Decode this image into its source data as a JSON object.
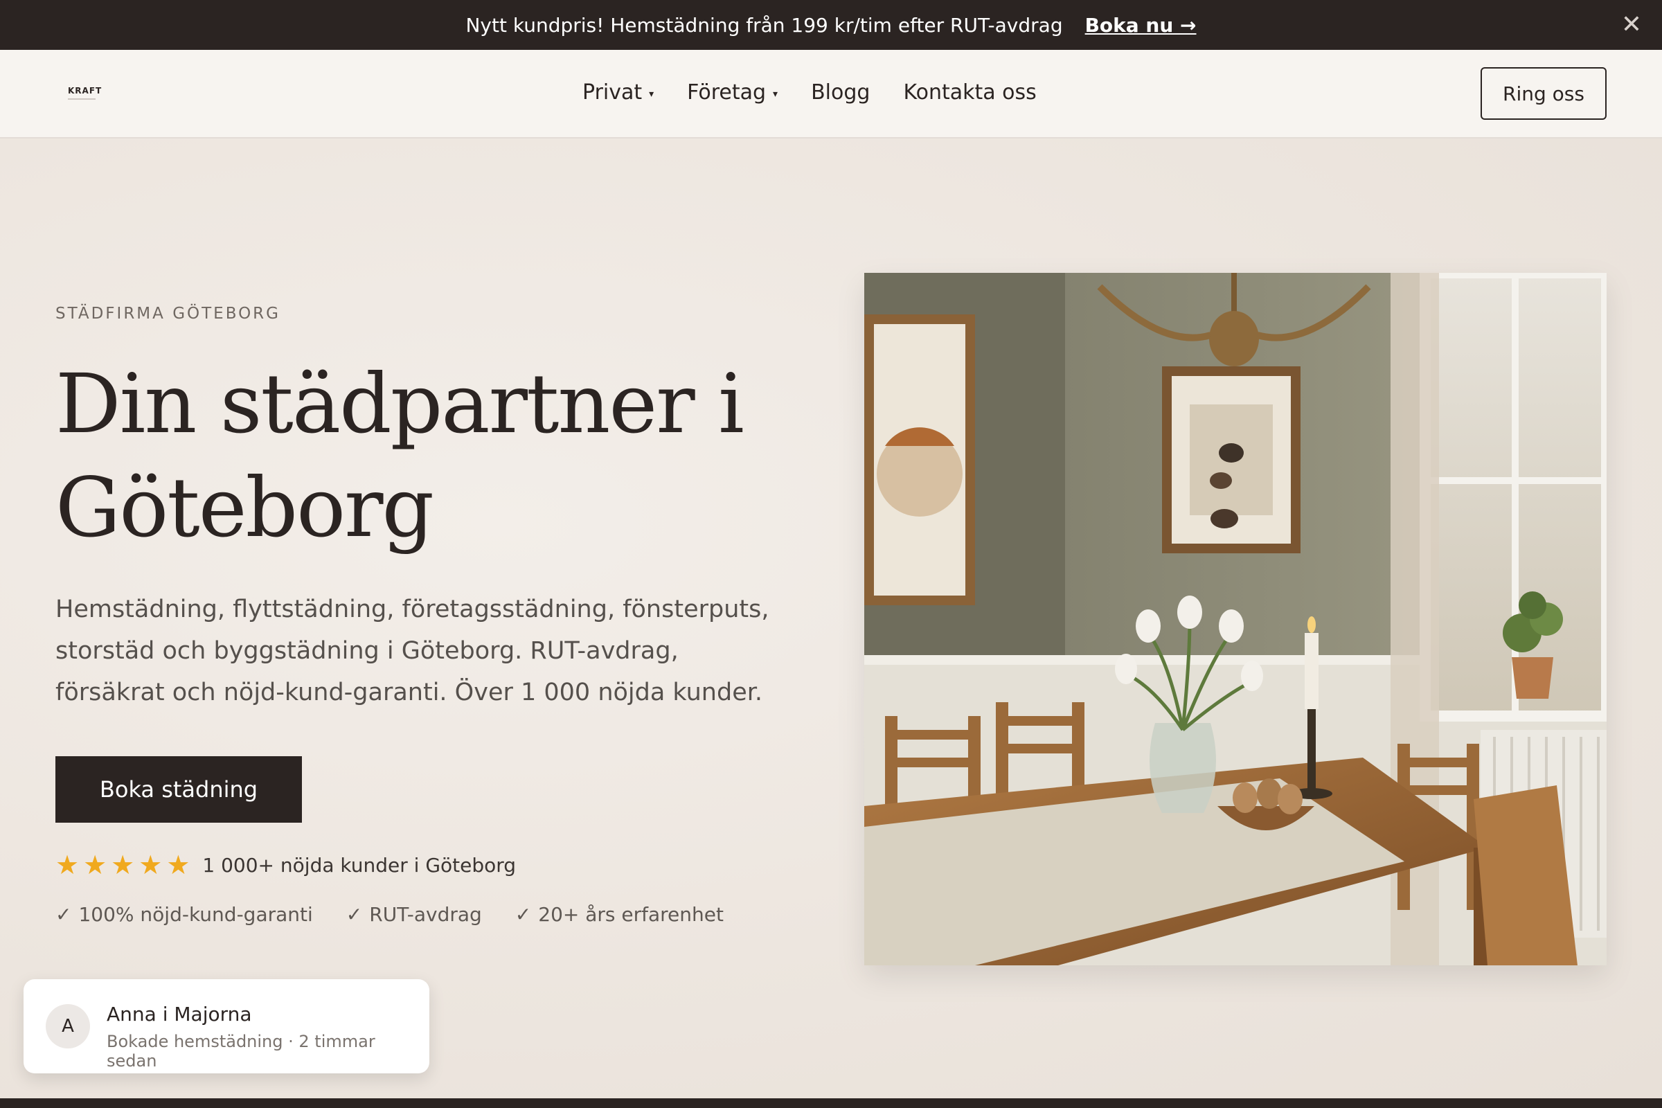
{
  "announcement": {
    "message": "Nytt kundpris! Hemstädning från 199 kr/tim efter RUT-avdrag",
    "cta": "Boka nu →",
    "close": "✕"
  },
  "header": {
    "logo": "KRAFT",
    "nav": [
      {
        "label": "Privat",
        "has_dropdown": true
      },
      {
        "label": "Företag",
        "has_dropdown": true
      },
      {
        "label": "Blogg",
        "has_dropdown": false
      },
      {
        "label": "Kontakta oss",
        "has_dropdown": false
      }
    ],
    "caret": "▾",
    "call_button": "Ring oss"
  },
  "hero": {
    "eyebrow": "STÄDFIRMA GÖTEBORG",
    "headline": "Din städpartner i Göteborg",
    "lead": "Hemstädning, flyttstädning, företagsstädning, fönsterputs, storstäd och byggstädning i Göteborg. RUT-avdrag, försäkrat och nöjd-kund-garanti. Över 1 000 nöjda kunder.",
    "cta": "Boka städning",
    "rating": {
      "stars": 5,
      "star_glyph": "★",
      "text": "1 000+ nöjda kunder i Göteborg"
    },
    "checks": [
      "100% nöjd-kund-garanti",
      "RUT-avdrag",
      "20+ års erfarenhet"
    ],
    "check_glyph": "✓"
  },
  "toast": {
    "avatar_letter": "A",
    "name": "Anna i Majorna",
    "detail": "Bokade hemstädning · 2 timmar sedan"
  },
  "colors": {
    "dark": "#2b2422",
    "background": "#efe8e2",
    "star": "#f0a91e"
  }
}
